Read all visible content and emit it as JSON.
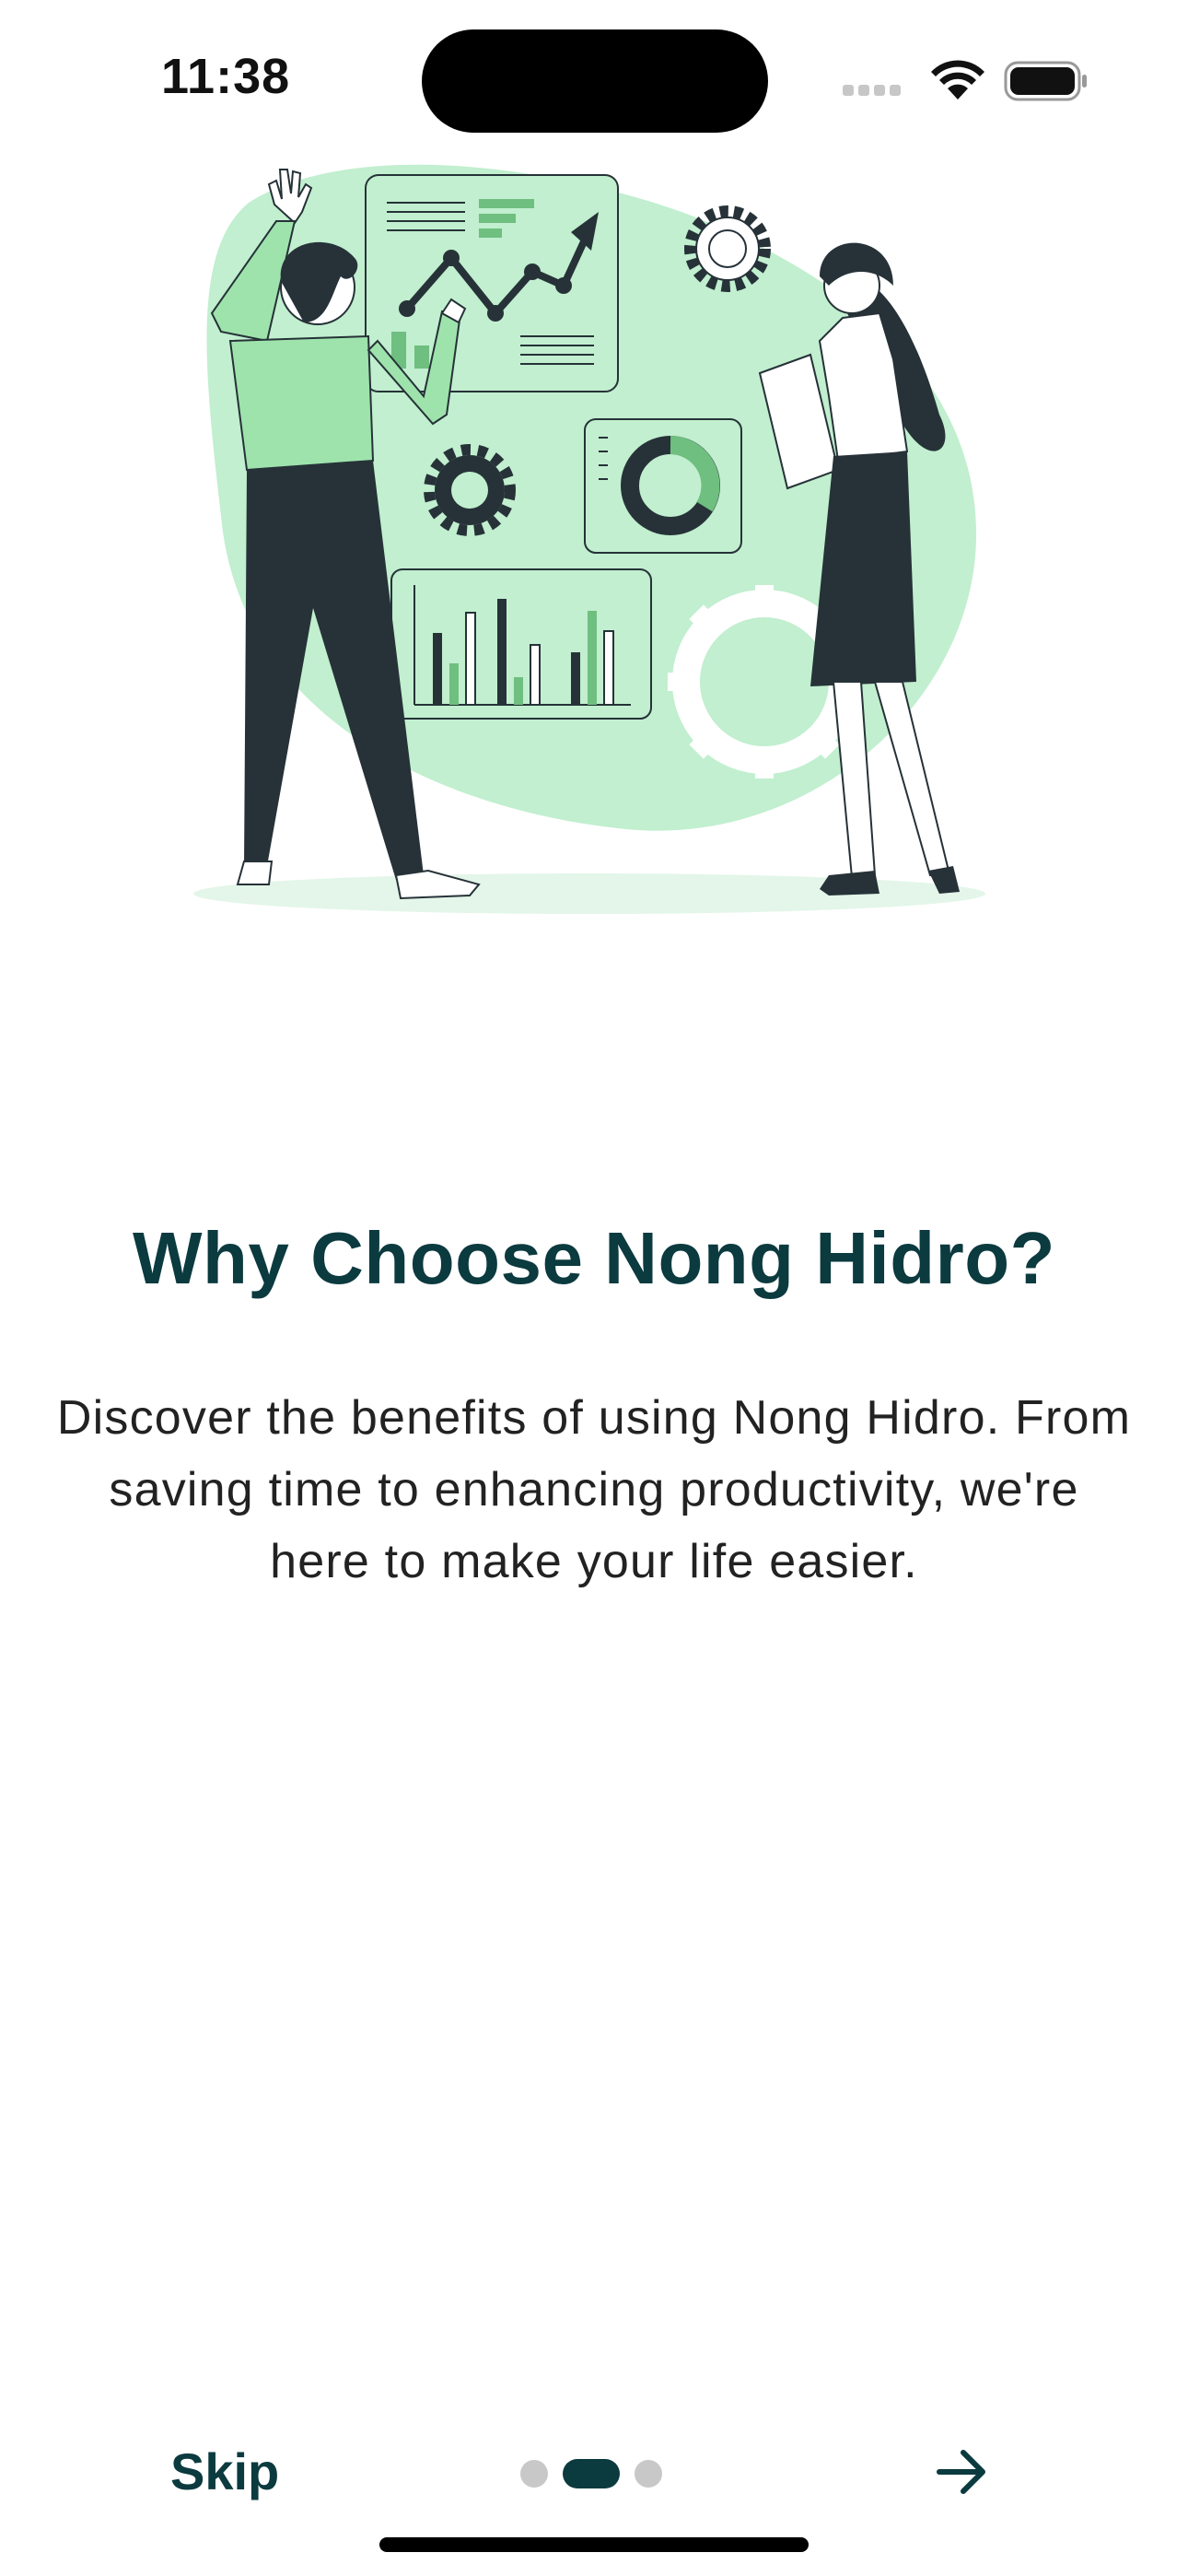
{
  "status_bar": {
    "time": "11:38"
  },
  "onboarding": {
    "title": "Why Choose Nong Hidro?",
    "description": "Discover the benefits of using Nong Hidro. From saving time to enhancing productivity, we're here to make your life easier.",
    "illustration_icon": "business-analytics-illustration"
  },
  "footer": {
    "skip_label": "Skip",
    "page_indicator": {
      "total": 3,
      "current": 2
    },
    "next_icon": "arrow-right-icon"
  },
  "colors": {
    "primary": "#0b3a3f",
    "accent_green": "#b9ecc8",
    "mid_green": "#7fbf8a",
    "dark_figure": "#263238",
    "dot_inactive": "#c8c8c8"
  }
}
